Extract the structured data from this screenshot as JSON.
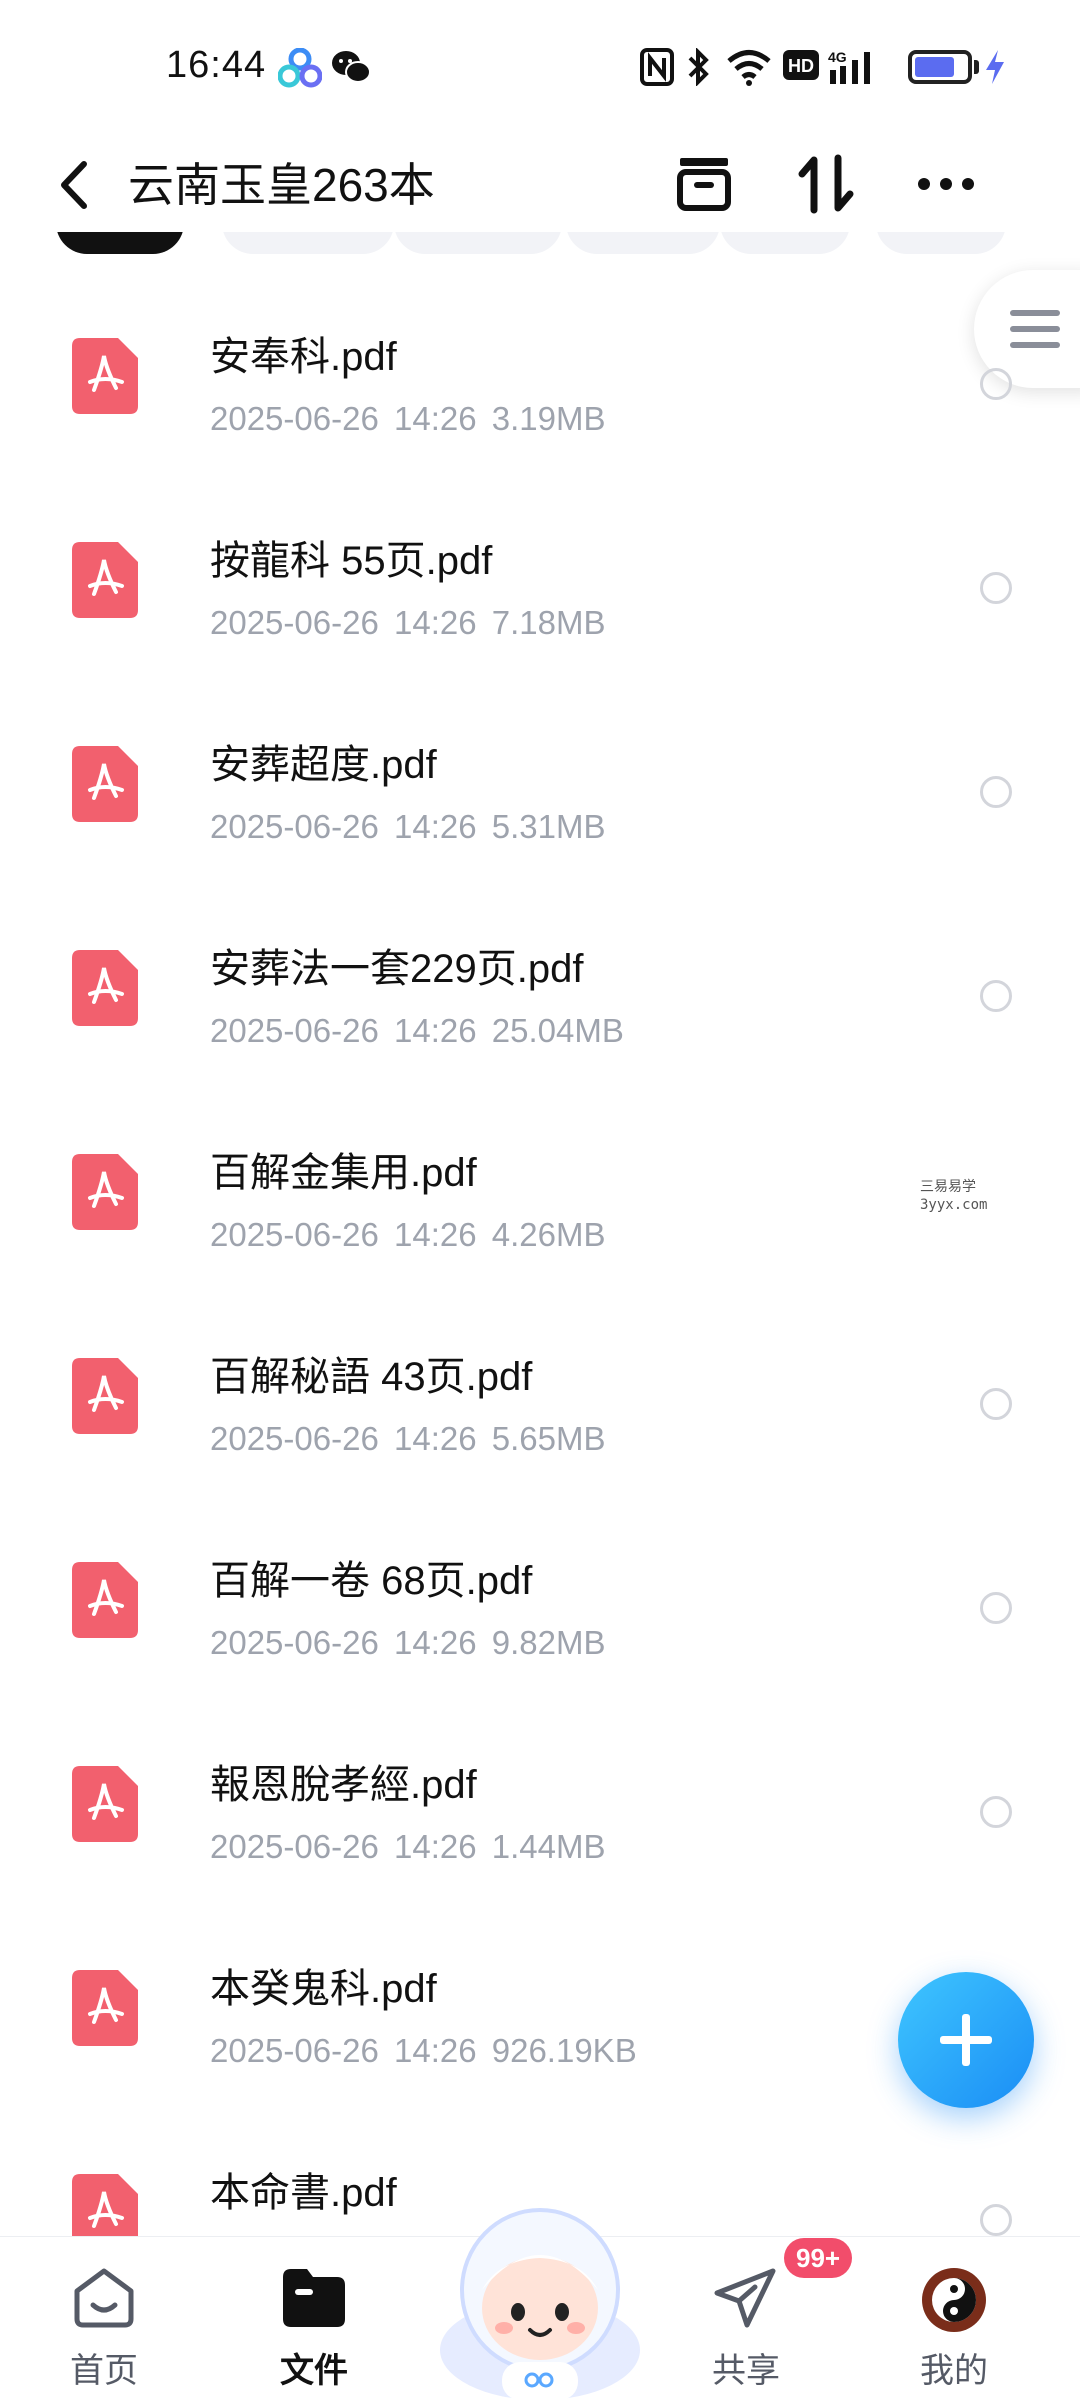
{
  "status_bar": {
    "time": "16:44",
    "icons": [
      "baidu-cloud-icon",
      "wechat-icon",
      "nfc-icon",
      "bluetooth-icon",
      "wifi-icon",
      "hd-icon",
      "4g-signal-icon",
      "battery-icon",
      "charging-icon"
    ]
  },
  "header": {
    "title": "云南玉皇263本",
    "actions": [
      "archive-icon",
      "sort-icon",
      "more-icon"
    ]
  },
  "files": [
    {
      "name": "安奉科.pdf",
      "date": "2025-06-26",
      "time": "14:26",
      "size": "3.19MB"
    },
    {
      "name": "按龍科 55页.pdf",
      "date": "2025-06-26",
      "time": "14:26",
      "size": "7.18MB"
    },
    {
      "name": "安葬超度.pdf",
      "date": "2025-06-26",
      "time": "14:26",
      "size": "5.31MB"
    },
    {
      "name": "安葬法一套229页.pdf",
      "date": "2025-06-26",
      "time": "14:26",
      "size": "25.04MB"
    },
    {
      "name": "百解金集用.pdf",
      "date": "2025-06-26",
      "time": "14:26",
      "size": "4.26MB"
    },
    {
      "name": "百解秘語 43页.pdf",
      "date": "2025-06-26",
      "time": "14:26",
      "size": "5.65MB"
    },
    {
      "name": "百解一卷 68页.pdf",
      "date": "2025-06-26",
      "time": "14:26",
      "size": "9.82MB"
    },
    {
      "name": "報恩脫孝經.pdf",
      "date": "2025-06-26",
      "time": "14:26",
      "size": "1.44MB"
    },
    {
      "name": "本癸鬼科.pdf",
      "date": "2025-06-26",
      "time": "14:26",
      "size": "926.19KB"
    },
    {
      "name": "本命書.pdf",
      "date": "",
      "time": "",
      "size": ""
    }
  ],
  "watermark": {
    "line1": "三易易学",
    "line2": "3yyx.com"
  },
  "bottom_nav": {
    "home": "首页",
    "files": "文件",
    "share": "共享",
    "mine": "我的",
    "share_badge": "99+"
  },
  "colors": {
    "pdf_red": "#f2606e",
    "fab_blue": "#1a8df5",
    "badge": "#f24d6b",
    "meta_gray": "#9ea3ad"
  }
}
